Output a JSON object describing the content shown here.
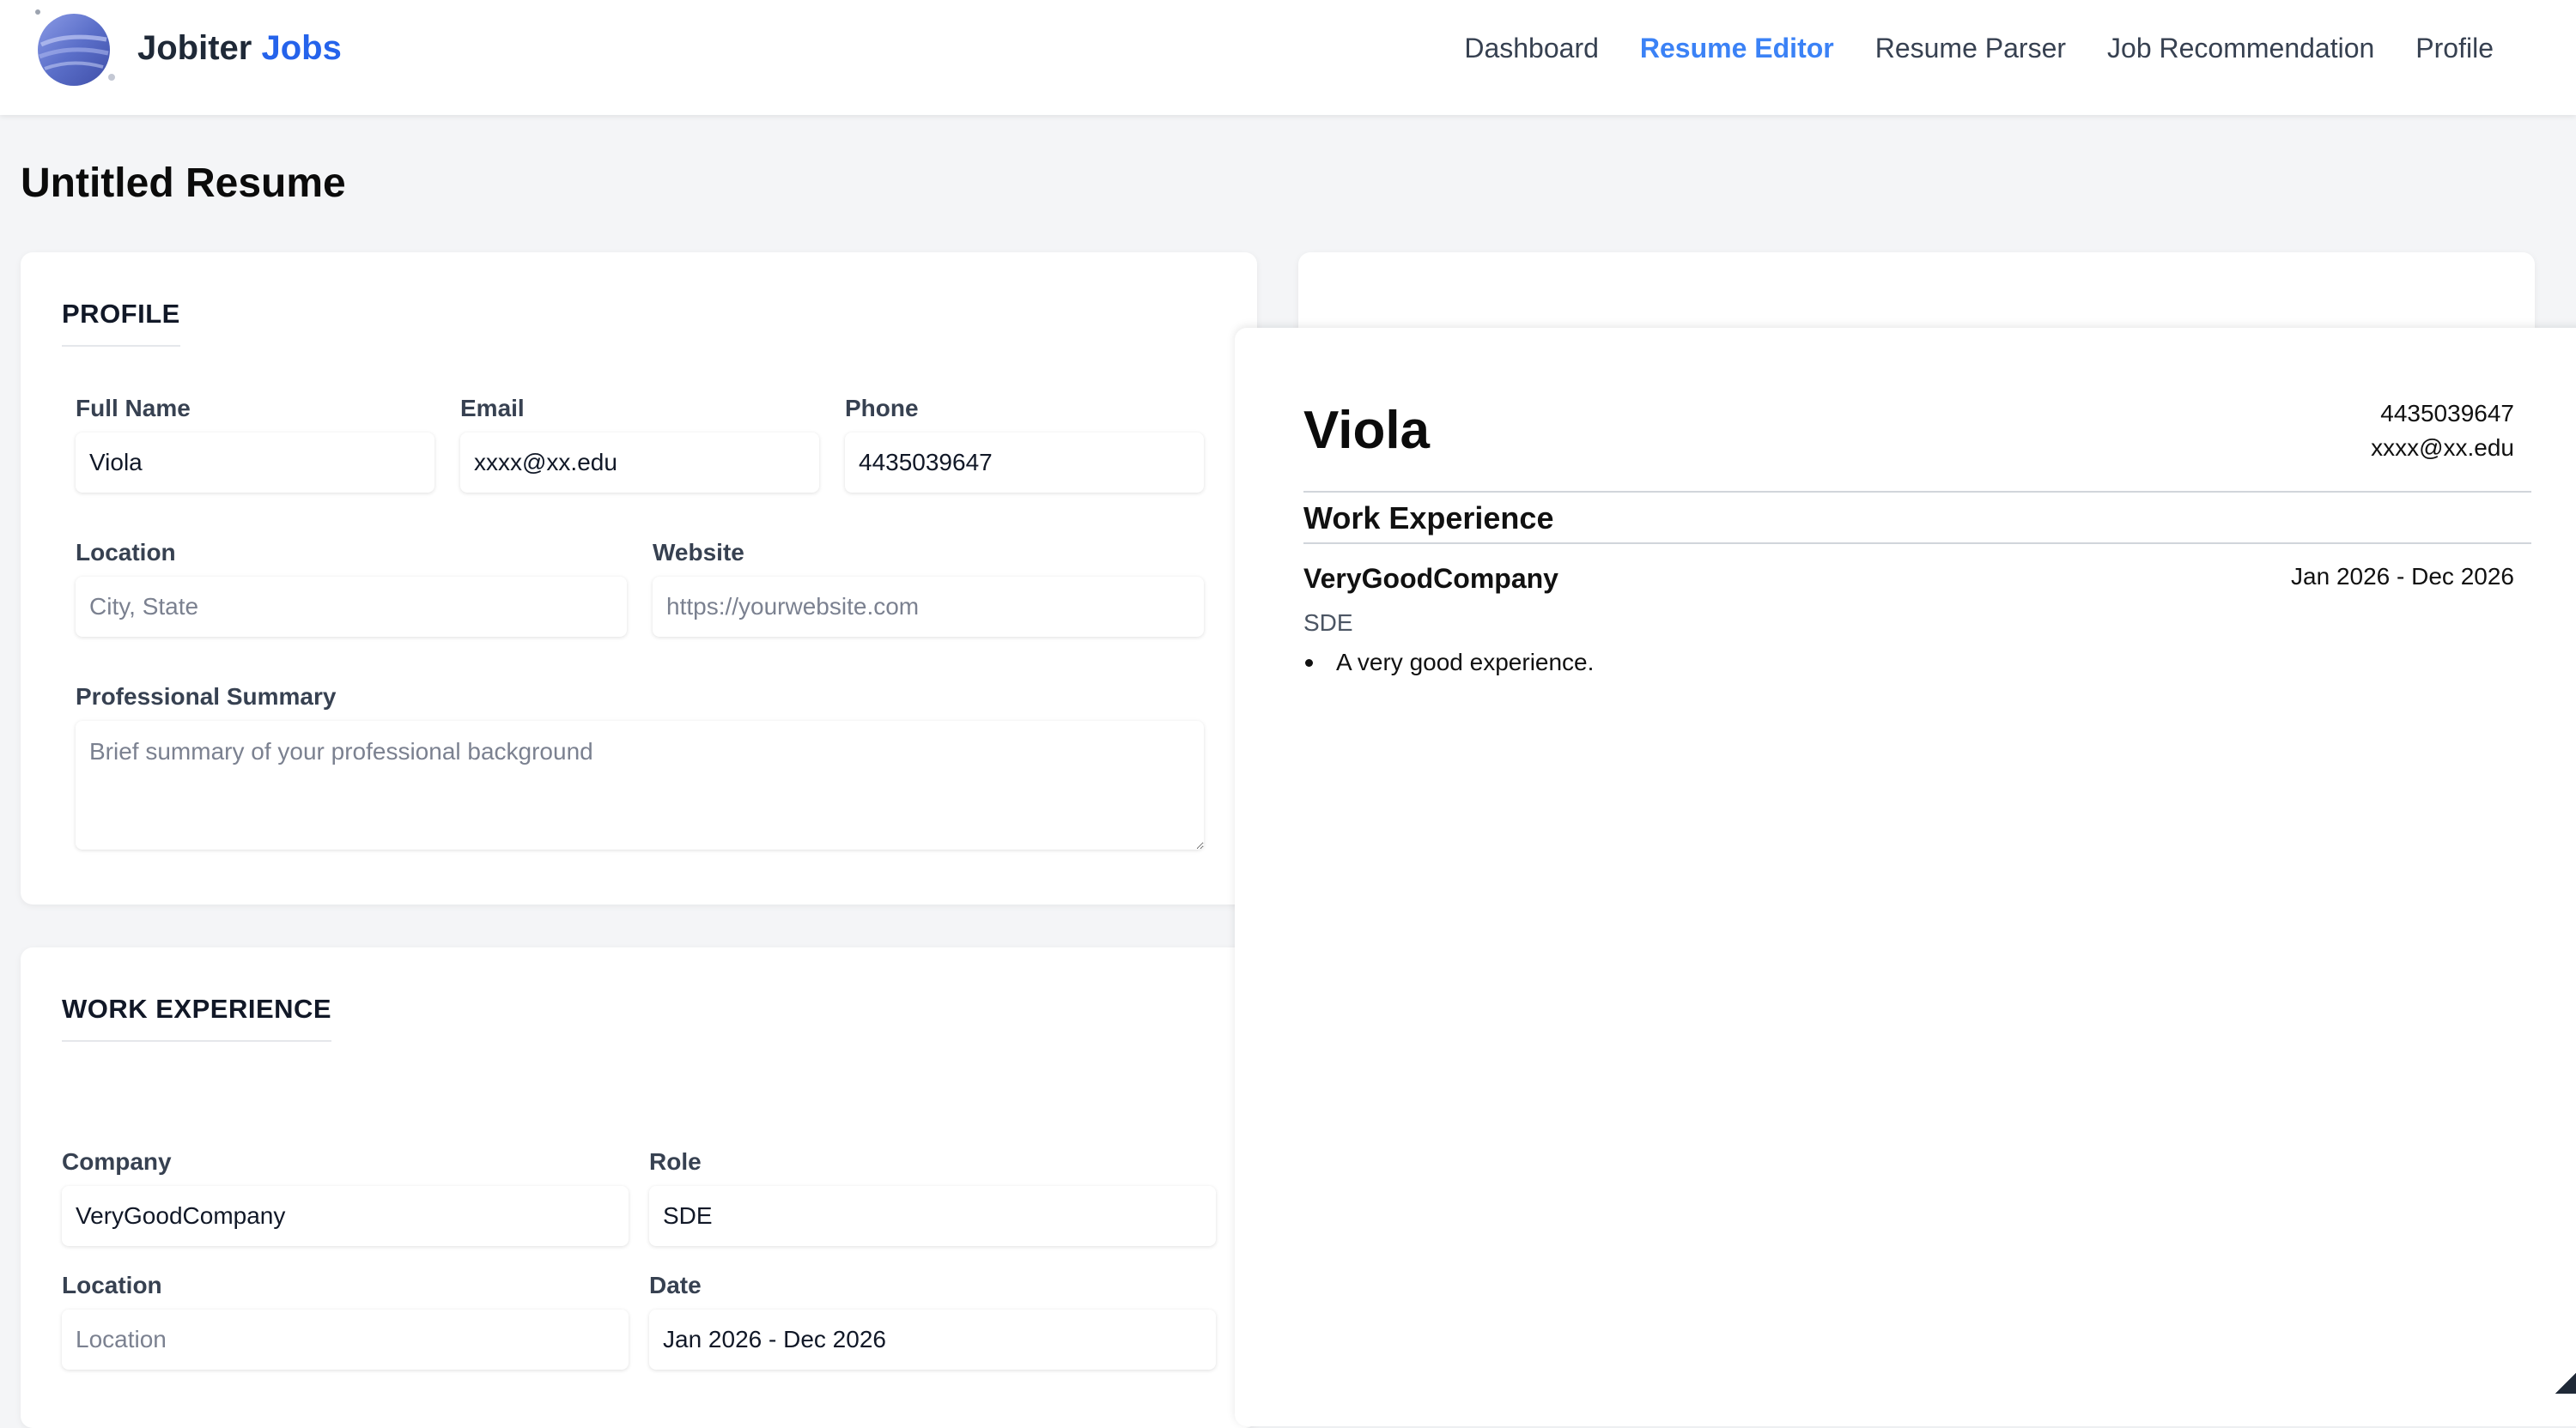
{
  "brand": {
    "name": "Jobiter",
    "accent": "Jobs"
  },
  "nav": {
    "items": [
      {
        "label": "Dashboard"
      },
      {
        "label": "Resume Editor",
        "active": true
      },
      {
        "label": "Resume Parser"
      },
      {
        "label": "Job Recommendation"
      },
      {
        "label": "Profile"
      }
    ],
    "active_color": "#3b82f6"
  },
  "page": {
    "title": "Untitled Resume"
  },
  "profile": {
    "heading": "PROFILE",
    "full_name": {
      "label": "Full Name",
      "value": "Viola"
    },
    "email": {
      "label": "Email",
      "value": "xxxx@xx.edu"
    },
    "phone": {
      "label": "Phone",
      "value": "4435039647"
    },
    "location": {
      "label": "Location",
      "value": "",
      "placeholder": "City, State"
    },
    "website": {
      "label": "Website",
      "value": "",
      "placeholder": "https://yourwebsite.com"
    },
    "summary": {
      "label": "Professional Summary",
      "value": "",
      "placeholder": "Brief summary of your professional background"
    }
  },
  "work": {
    "heading": "WORK EXPERIENCE",
    "company": {
      "label": "Company",
      "value": "VeryGoodCompany"
    },
    "role": {
      "label": "Role",
      "value": "SDE"
    },
    "location": {
      "label": "Location",
      "value": "",
      "placeholder": "Location"
    },
    "date": {
      "label": "Date",
      "value": "Jan 2026 - Dec 2026"
    }
  },
  "preview": {
    "name": "Viola",
    "phone": "4435039647",
    "email": "xxxx@xx.edu",
    "section_title": "Work Experience",
    "company": "VeryGoodCompany",
    "date": "Jan 2026 - Dec 2026",
    "role": "SDE",
    "bullets": [
      "A very good experience."
    ]
  }
}
